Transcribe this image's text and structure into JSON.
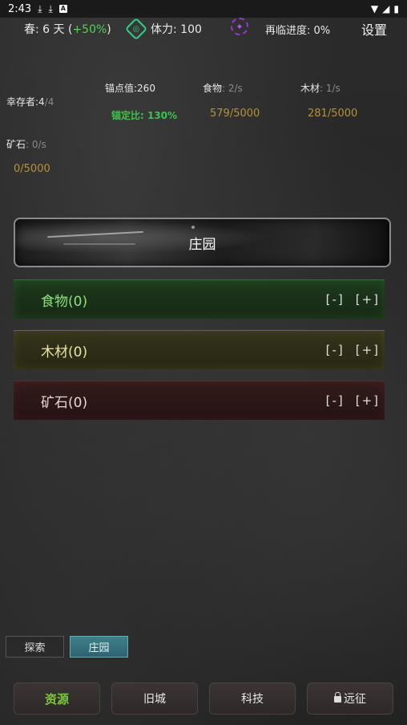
{
  "statusbar": {
    "time": "2:43",
    "icons": [
      "download-icon",
      "download-icon",
      "a-box-icon"
    ],
    "right_icons": [
      "wifi-icon",
      "signal-icon",
      "battery-icon"
    ]
  },
  "topbar": {
    "season_label": "春: 6 天 (",
    "season_bonus": "+50%",
    "season_close": ")",
    "stamina_label": "体力: 100",
    "progress_label": "再临进度: 0%",
    "settings_label": "设置"
  },
  "stats": {
    "survivors_label": "幸存者:4",
    "survivors_max": "/4",
    "anchor_value": "锚点值:260",
    "anchor_ratio": "锚定比: 130%",
    "food_label": "食物",
    "food_rate": ": 2/s",
    "food_amount": "579/5000",
    "wood_label": "木材",
    "wood_rate": ": 1/s",
    "wood_amount": "281/5000",
    "ore_label": "矿石",
    "ore_rate": ": 0/s",
    "ore_amount": "0/5000"
  },
  "panel": {
    "title": "庄园"
  },
  "resources": [
    {
      "label": "食物(0)",
      "minus": "[-]",
      "plus": "[+]"
    },
    {
      "label": "木材(0)",
      "minus": "[-]",
      "plus": "[+]"
    },
    {
      "label": "矿石(0)",
      "minus": "[-]",
      "plus": "[+]"
    }
  ],
  "subtabs": {
    "explore": "探索",
    "estate": "庄园"
  },
  "nav": {
    "resources": "资源",
    "old_city": "旧城",
    "tech": "科技",
    "expedition": "远征"
  }
}
